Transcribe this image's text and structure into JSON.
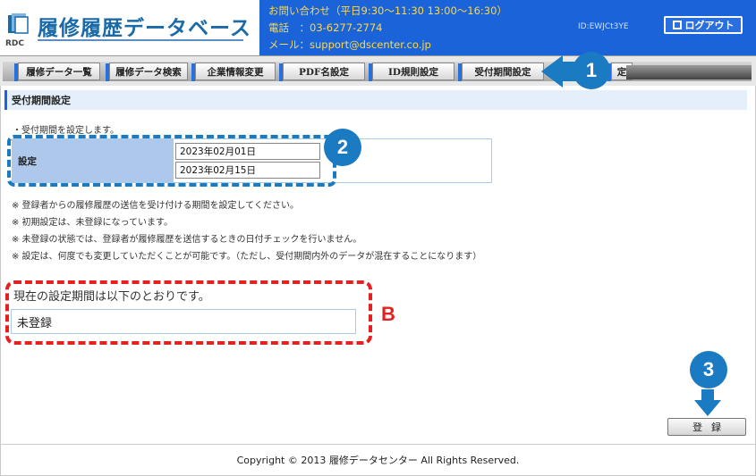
{
  "header": {
    "logo_text": "履修履歴データベース",
    "logo_sub": "RDC",
    "contact_hours": "お問い合わせ（平日9:30～11:30 13:00～16:30）",
    "contact_phone": "電話　：03-6277-2774",
    "contact_mail_label": "メール：",
    "contact_mail": "support@dscenter.co.jp",
    "user_id": "ID:EWJCt3YE",
    "logout_label": "ログアウト"
  },
  "nav": {
    "tabs": [
      {
        "label": "履修データ一覧"
      },
      {
        "label": "履修データ検索"
      },
      {
        "label": "企業情報変更"
      },
      {
        "label": "PDF名設定"
      },
      {
        "label": "ID規則設定"
      },
      {
        "label": "受付期間設定"
      },
      {
        "label": "定"
      }
    ]
  },
  "page": {
    "section_title": "受付期間設定",
    "intro": "・受付期間を設定します。",
    "setting_label": "設定",
    "start_date": "2023年02月01日",
    "end_date": "2023年02月15日",
    "notes": [
      "※ 登録者からの履修履歴の送信を受け付ける期間を設定してください。",
      "※ 初期設定は、未登録になっています。",
      "※ 未登録の状態では、登録者が履修履歴を送信するときの日付チェックを行いません。",
      "※ 設定は、何度でも変更していただくことが可能です。（ただし、受付期間内外のデータが混在することになります）"
    ],
    "current_label": "現在の設定期間は以下のとおりです。",
    "current_value": "未登録",
    "register_label": "登録"
  },
  "footer": {
    "copyright": "Copyright © 2013 履修データセンター All Rights Reserved."
  },
  "annotations": {
    "callout_1": "1",
    "callout_2": "2",
    "callout_3": "3",
    "label_b": "B",
    "accent_blue": "#1a7ac2",
    "accent_red": "#e52020"
  }
}
